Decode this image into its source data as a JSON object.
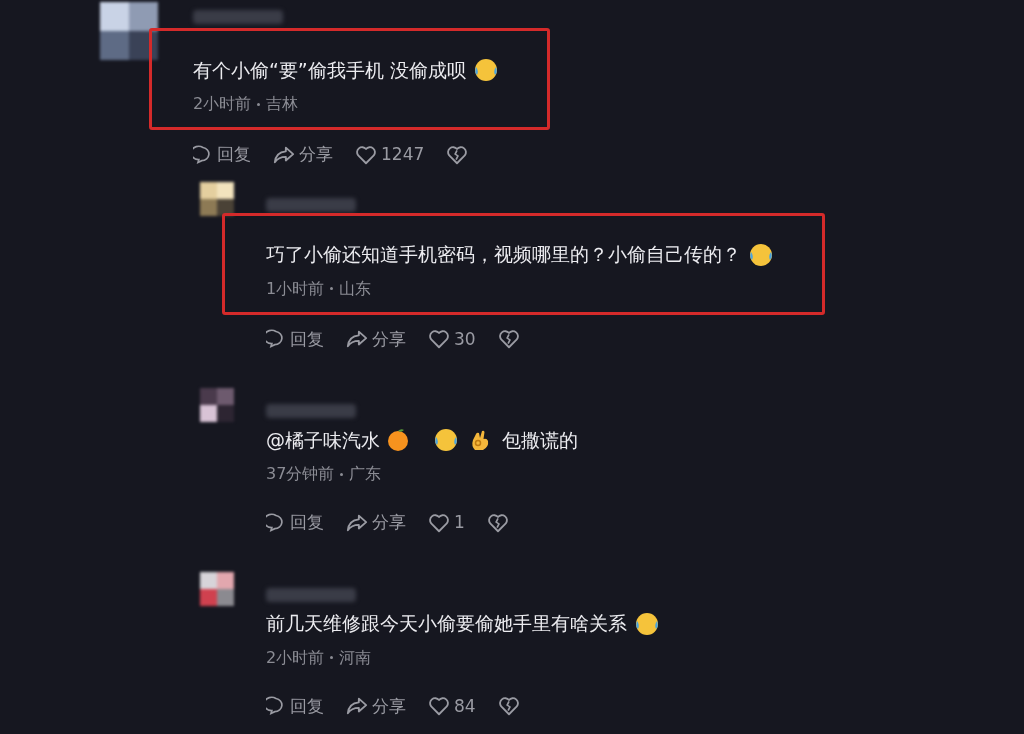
{
  "comments": [
    {
      "highlighted": true,
      "body": [
        {
          "kind": "text",
          "text": "有个小偷“要”偷我手机 没偷成呗"
        },
        {
          "kind": "emoji"
        }
      ],
      "time": "2小时前",
      "location": "吉林",
      "reply_label": "回复",
      "share_label": "分享",
      "likes": "1247",
      "replies": [
        {
          "highlighted": true,
          "body": [
            {
              "kind": "text",
              "text": "巧了小偷还知道手机密码，视频哪里的？小偷自己传的？"
            },
            {
              "kind": "emoji"
            }
          ],
          "time": "1小时前",
          "location": "山东",
          "reply_label": "回复",
          "share_label": "分享",
          "likes": "30"
        },
        {
          "highlighted": false,
          "body": [
            {
              "kind": "mention",
              "text": "@橘子味汽水"
            },
            {
              "kind": "orange"
            },
            {
              "kind": "emoji"
            },
            {
              "kind": "hand"
            },
            {
              "kind": "text",
              "text": "包撒谎的"
            }
          ],
          "time": "37分钟前",
          "location": "广东",
          "reply_label": "回复",
          "share_label": "分享",
          "likes": "1"
        },
        {
          "highlighted": false,
          "body": [
            {
              "kind": "text",
              "text": "前几天维修跟今天小偷要偷她手里有啥关系"
            },
            {
              "kind": "emoji"
            }
          ],
          "time": "2小时前",
          "location": "河南",
          "reply_label": "回复",
          "share_label": "分享",
          "likes": "84"
        }
      ]
    }
  ]
}
